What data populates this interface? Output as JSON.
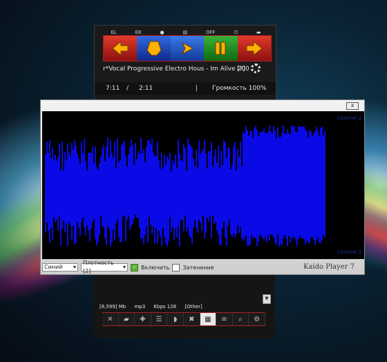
{
  "player": {
    "top_icons": [
      "EL",
      "EK",
      "",
      "",
      "OFF",
      "",
      ""
    ],
    "nav_buttons": [
      "prev",
      "stop",
      "play",
      "pause",
      "next"
    ],
    "track_title": "r*Vocal Progressive Electro Hous - Im Alive 200",
    "help_label": "[?]",
    "time_elapsed": "7:11",
    "time_sep": "/",
    "time_total": "2:11",
    "divider": "|",
    "volume_label": "Громкость 100%"
  },
  "visualizer": {
    "channel_label_top": "Channel 2",
    "channel_label_bottom": "Channel 2",
    "color_select": "Синий",
    "density_select": "Плотность [2]",
    "enable_label": "Включить",
    "enable_checked": true,
    "fade_label": "Затенение",
    "fade_checked": false,
    "brand": "Kaido Player 7",
    "close_label": "x",
    "bar_color": "#0a0ae6"
  },
  "status": {
    "size": "[6,599] Mb",
    "format": "mp3",
    "bitrate": "Kbps 128",
    "other": "[Other]"
  },
  "toolbar": {
    "tools": [
      "shuffle",
      "folder",
      "add",
      "list",
      "repeat",
      "remove",
      "equalizer",
      "menu",
      "search",
      "settings"
    ]
  }
}
